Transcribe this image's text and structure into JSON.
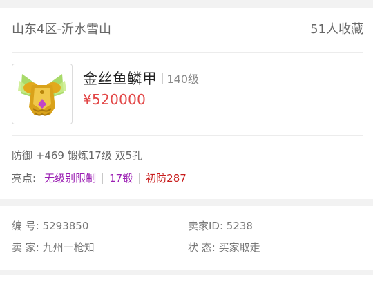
{
  "header": {
    "server": "山东4区-沂水雪山",
    "favorites": "51人收藏"
  },
  "item": {
    "name": "金丝鱼鳞甲",
    "level": "140级",
    "price": "¥520000",
    "icon": "golden-armor-icon"
  },
  "attributes": "防御 +469 锻炼17级 双5孔",
  "highlights": {
    "label": "亮点:",
    "tags": [
      "无级别限制",
      "17锻",
      "初防287"
    ],
    "colors": [
      "#9b1fb3",
      "#9b1fb3",
      "#c81c1c"
    ]
  },
  "info": {
    "id_label": "编 号: 5293850",
    "seller_id_label": "卖家ID: 5238",
    "seller_label": "卖 家: 九州一枪知",
    "status_label": "状 态: 买家取走"
  },
  "colors": {
    "price": "#e24646",
    "background": "#f2f2f2",
    "card": "#ffffff"
  }
}
